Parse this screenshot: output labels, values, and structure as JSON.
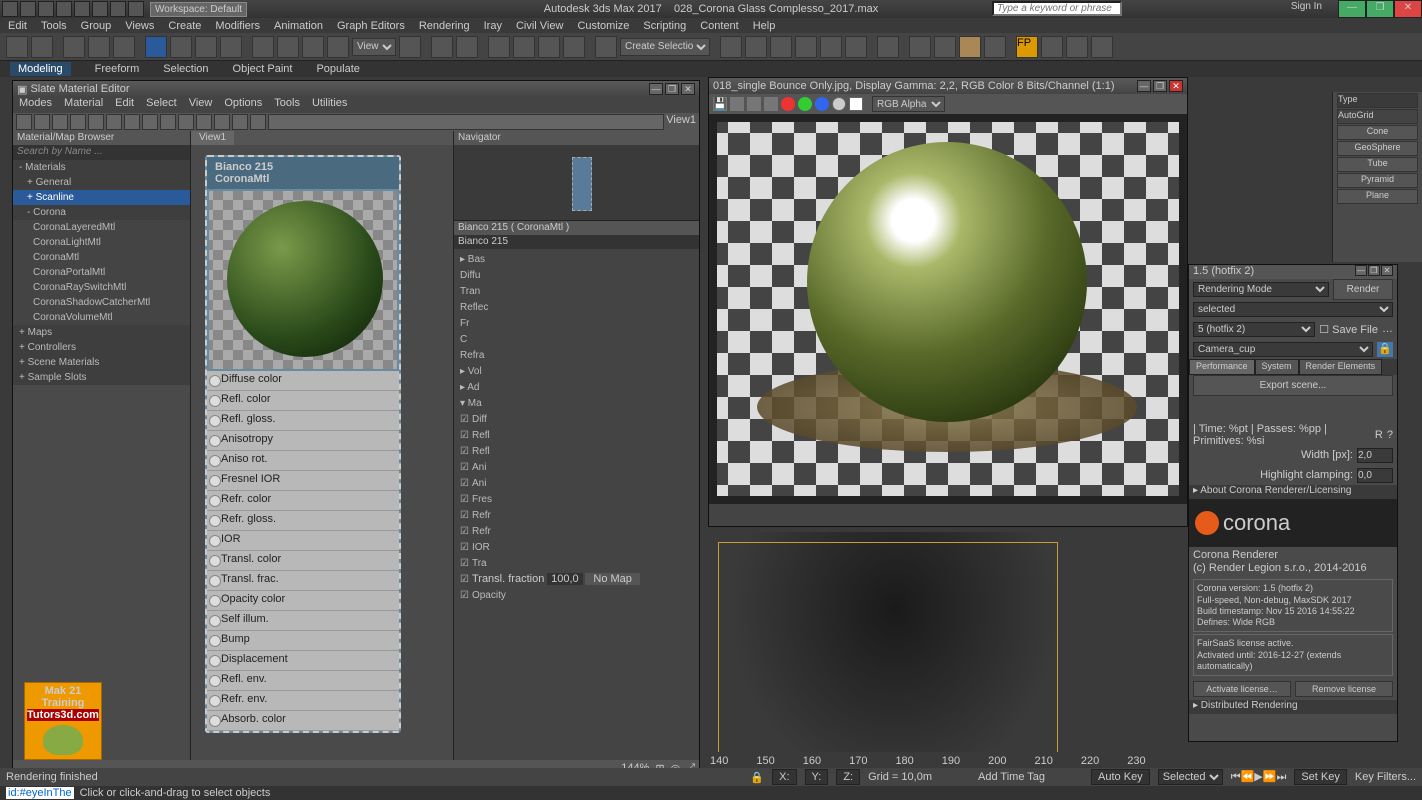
{
  "app": {
    "title_left": "Autodesk 3ds Max 2017",
    "title_file": "028_Corona Glass Complesso_2017.max",
    "workspace_label": "Workspace: Default",
    "search_placeholder": "Type a keyword or phrase",
    "signin": "Sign In"
  },
  "menu": [
    "Edit",
    "Tools",
    "Group",
    "Views",
    "Create",
    "Modifiers",
    "Animation",
    "Graph Editors",
    "Rendering",
    "Iray",
    "Civil View",
    "Customize",
    "Scripting",
    "Content",
    "Help"
  ],
  "toolbar": {
    "view_dd": "View",
    "create_sel": "Create Selection Se"
  },
  "modes": [
    "Modeling",
    "Freeform",
    "Selection",
    "Object Paint",
    "Populate"
  ],
  "sme": {
    "title": "Slate Material Editor",
    "menu": [
      "Modes",
      "Material",
      "Edit",
      "Select",
      "View",
      "Options",
      "Tools",
      "Utilities"
    ],
    "browser_title": "Material/Map Browser",
    "search_placeholder": "Search by Name ...",
    "tree": {
      "materials": "- Materials",
      "general": "+ General",
      "scanline": "+ Scanline",
      "corona": "- Corona",
      "corona_items": [
        "CoronaLayeredMtl",
        "CoronaLightMtl",
        "CoronaMtl",
        "CoronaPortalMtl",
        "CoronaRaySwitchMtl",
        "CoronaShadowCatcherMtl",
        "CoronaVolumeMtl"
      ],
      "maps": "+ Maps",
      "controllers": "+ Controllers",
      "scene": "+ Scene Materials",
      "sample": "+ Sample Slots"
    },
    "view_tab": "View1",
    "node": {
      "name": "Bianco 215",
      "type": "CoronaMtl",
      "slots": [
        "Diffuse color",
        "Refl. color",
        "Refl. gloss.",
        "Anisotropy",
        "Aniso rot.",
        "Fresnel IOR",
        "Refr. color",
        "Refr. gloss.",
        "IOR",
        "Transl. color",
        "Transl. frac.",
        "Opacity color",
        "Self illum.",
        "Bump",
        "Displacement",
        "Refl. env.",
        "Refr. env.",
        "Absorb. color"
      ]
    },
    "nav_title": "Navigator",
    "param_title": "Bianco 215  ( CoronaMtl )",
    "param_name": "Bianco 215",
    "param_rows": [
      "▸ Bas",
      "Diffu",
      "Tran",
      "Reflec",
      "Fr",
      "C",
      "Refra",
      "▸ Vol",
      "▸ Ad",
      "▾ Ma"
    ],
    "param_checks": [
      "Diff",
      "Refl",
      "Refl",
      "Ani",
      "Ani",
      "Fres",
      "Refr",
      "Refr",
      "IOR",
      "Tra"
    ],
    "transl_frac_label": "Transl. fraction",
    "transl_frac_val": "100,0",
    "nomap": "No Map",
    "opacity_label": "Opacity",
    "status_view": "View1",
    "status_pct": "144%"
  },
  "fb": {
    "title": "018_single Bounce Only.jpg, Display Gamma: 2,2, RGB Color 8 Bits/Channel (1:1)",
    "channel": "RGB Alpha"
  },
  "rpanel": {
    "type": "Type",
    "autogrid": "AutoGrid",
    "shapes": [
      "Cone",
      "GeoSphere",
      "Tube",
      "Pyramid",
      "Plane"
    ]
  },
  "corona": {
    "title": "1.5 (hotfix 2)",
    "rendering_mode": "Rendering Mode",
    "render": "Render",
    "selected": "selected",
    "hotfix": "5 (hotfix 2)",
    "save_file": "Save File",
    "camera": "Camera_cup",
    "tabs": [
      "Performance",
      "System",
      "Render Elements"
    ],
    "export": "Export scene...",
    "stats": "| Time: %pt | Passes: %pp | Primitives: %si",
    "width_label": "Width [px]:",
    "width_val": "2,0",
    "clamp_label": "Highlight clamping:",
    "clamp_val": "0,0",
    "about": "▸ About Corona Renderer/Licensing",
    "logo_text": "corona",
    "info1": "Corona Renderer",
    "info2": "(c) Render Legion s.r.o., 2014-2016",
    "version": "Corona version: 1.5 (hotfix 2)\nFull-speed, Non-debug, MaxSDK 2017\nBuild timestamp: Nov 15 2016 14:55:22\nDefines: Wide RGB",
    "license": "FairSaaS license active.\nActivated until: 2016-12-27 (extends automatically)",
    "activate": "Activate license…",
    "remove": "Remove license",
    "distributed": "▸ Distributed Rendering"
  },
  "timeline": [
    "140",
    "150",
    "160",
    "170",
    "180",
    "190",
    "200",
    "210",
    "220",
    "230"
  ],
  "status": {
    "render": "Rendering finished",
    "x": "X:",
    "y": "Y:",
    "z": "Z:",
    "grid": "Grid = 10,0m",
    "add_tag": "Add Time Tag",
    "autokey": "Auto Key",
    "selected": "Selected",
    "setkey": "Set Key",
    "keyfilters": "Key Filters..."
  },
  "prompt": {
    "id": "id:#eyeInThe",
    "text": "Click or click-and-drag to select objects"
  },
  "wm": {
    "l1": "Mak 21 Training",
    "l2": "Tutors3d.com"
  }
}
